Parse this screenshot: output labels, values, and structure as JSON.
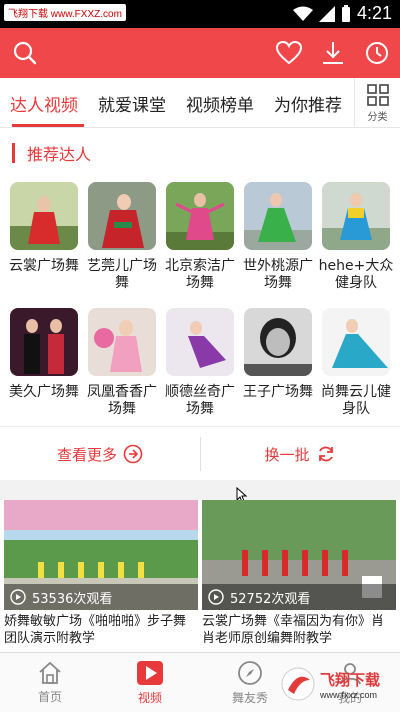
{
  "status_bar": {
    "watermark": "飞翔下载 www.FXXZ.com",
    "time": "4:21"
  },
  "top_bar": {
    "search_icon": "search-icon",
    "favorite_icon": "heart-icon",
    "download_icon": "download-icon",
    "history_icon": "history-icon"
  },
  "tabs": [
    {
      "label": "达人视频",
      "active": true
    },
    {
      "label": "就爱课堂",
      "active": false
    },
    {
      "label": "视频榜单",
      "active": false
    },
    {
      "label": "为你推荐",
      "active": false
    }
  ],
  "category": {
    "label": "分类"
  },
  "section": {
    "title": "推荐达人"
  },
  "people": [
    {
      "name": "云裳广场舞"
    },
    {
      "name": "艺莞儿广场舞"
    },
    {
      "name": "北京索洁广场舞"
    },
    {
      "name": "世外桃源广场舞"
    },
    {
      "name": "hehe+大众健身队"
    },
    {
      "name": "美久广场舞"
    },
    {
      "name": "凤凰香香广场舞"
    },
    {
      "name": "顺德丝奇广场舞"
    },
    {
      "name": "王子广场舞"
    },
    {
      "name": "尚舞云儿健身队"
    }
  ],
  "actions": {
    "more": "查看更多",
    "refresh": "换一批"
  },
  "videos": [
    {
      "views": "53536次观看",
      "title": "娇舞敏敏广场《啪啪啪》步子舞团队演示附教学"
    },
    {
      "views": "52752次观看",
      "title": "云裳广场舞《幸福因为有你》肖肖老师原创编舞附教学"
    }
  ],
  "bottom_nav": [
    {
      "label": "首页",
      "active": false
    },
    {
      "label": "视频",
      "active": true
    },
    {
      "label": "舞友秀",
      "active": false
    },
    {
      "label": "我的",
      "active": false
    }
  ],
  "watermark_logo": {
    "brand": "飞翔下载",
    "url": "www.fxxz.com"
  },
  "colors": {
    "accent": "#e8393b",
    "topbar": "#f0484a"
  }
}
